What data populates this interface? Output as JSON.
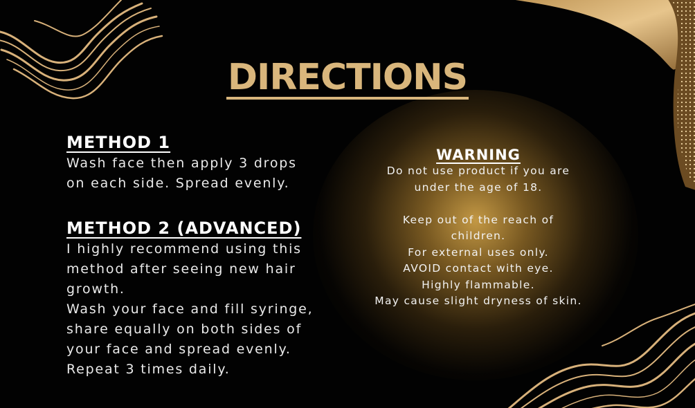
{
  "page": {
    "title": "DIRECTIONS",
    "colors": {
      "background": "#020202",
      "gold": "#d9b67c",
      "text": "#f2f2f2"
    }
  },
  "method1": {
    "heading": "METHOD 1",
    "text": "Wash face then apply 3 drops\non each side. Spread evenly."
  },
  "method2": {
    "heading": "METHOD 2 (ADVANCED)",
    "text": "I highly recommend using this\nmethod after seeing new hair\ngrowth.\nWash your face and fill syringe,\nshare equally on both sides of\nyour face and spread evenly.\nRepeat 3 times daily."
  },
  "warning": {
    "heading": "WARNING",
    "lines": [
      "Do not use product if you are",
      "under the age of 18.",
      "",
      "Keep out of the reach of",
      "children.",
      "For external uses only.",
      "AVOID contact with eye.",
      "Highly flammable.",
      "May cause slight dryness of skin."
    ]
  },
  "decor": {
    "icons": [
      "gold-swirl-top-left",
      "gold-swirl-bottom-right",
      "gold-wave-corner"
    ]
  }
}
